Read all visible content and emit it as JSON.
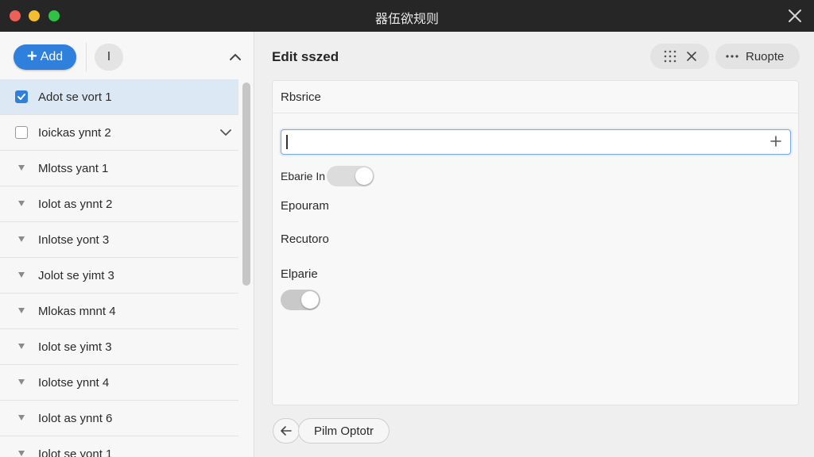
{
  "window": {
    "title": "器伍欲规则"
  },
  "sidebar": {
    "add_label": "Add",
    "round_button_label": "I",
    "items": [
      {
        "label": "Adot se vort 1",
        "selected": true,
        "checked": true,
        "control": "checkbox"
      },
      {
        "label": "Ioickas ynnt 2",
        "selected": false,
        "checked": false,
        "control": "checkbox",
        "expandable": true
      },
      {
        "label": "Mlotss yant 1",
        "control": "triangle-icon"
      },
      {
        "label": "Iolot as ynnt 2",
        "control": "triangle-icon"
      },
      {
        "label": "Inlotse yont 3",
        "control": "triangle-icon"
      },
      {
        "label": "Jolot se yimt 3",
        "control": "triangle-icon"
      },
      {
        "label": "Mlokas mnnt 4",
        "control": "triangle-icon"
      },
      {
        "label": "Iolot se yimt 3",
        "control": "triangle-icon"
      },
      {
        "label": "Iolotse ynnt 4",
        "control": "triangle-icon"
      },
      {
        "label": "Iolot as ynnt 6",
        "control": "triangle-icon"
      },
      {
        "label": "Iolot se yont 1",
        "control": "triangle-icon"
      }
    ]
  },
  "main": {
    "title": "Edit sszed",
    "toolbar": {
      "more_label": "Ruopte"
    },
    "panel": {
      "header": "Rbsrice",
      "input": {
        "value": "",
        "placeholder": ""
      },
      "toggle_label": "Ebarie In",
      "toggle_on": false,
      "fields": [
        "Epouram",
        "Recutoro",
        "Elparie"
      ],
      "bottom_toggle_on": false
    },
    "footer": {
      "option_label": "Pilm Optotr"
    }
  },
  "colors": {
    "accent": "#2f7fdc",
    "titlebar": "#262626",
    "selected_row": "#dde8f5"
  }
}
